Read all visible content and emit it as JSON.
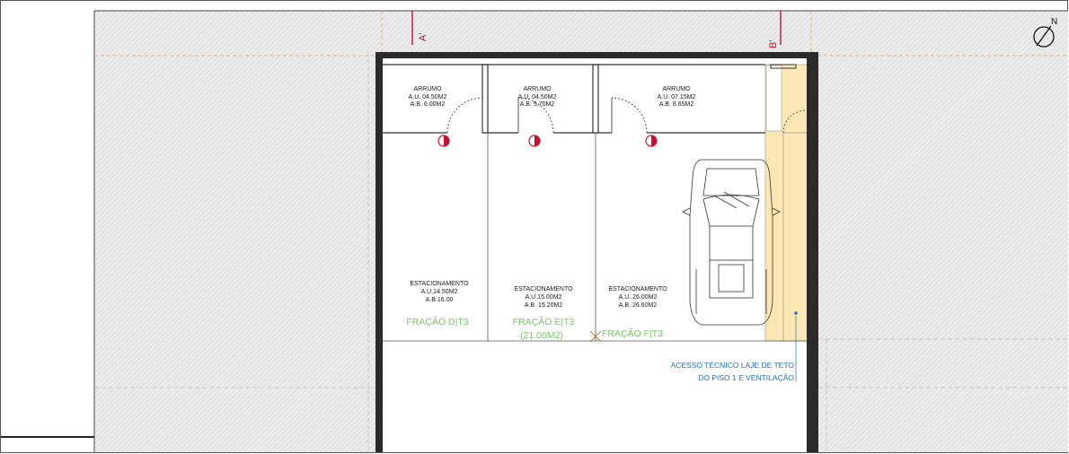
{
  "section_marks": {
    "a": "A'",
    "b": "B'"
  },
  "north_label": "N",
  "storage": [
    {
      "title": "ARRUMO",
      "au": "A.U. 04.50M2",
      "ab": "A.B. 6.00M2"
    },
    {
      "title": "ARRUMO",
      "au": "A.U. 04.50M2",
      "ab": "A.B. 5.70M2"
    },
    {
      "title": "ARRUMO",
      "au": "A.U. 07.15M2",
      "ab": "A.B. 8.65M2"
    }
  ],
  "parking": [
    {
      "title": "ESTACIONAMENTO",
      "au": "A.U.14.50M2",
      "ab": "A.B.16.00",
      "fraction": "FRAÇÃO D|T3",
      "fraction_area": ""
    },
    {
      "title": "ESTACIONAMENTO",
      "au": "A.U.15.00M2",
      "ab": "A.B. 15.20M2",
      "fraction": "FRAÇÃO E|T3",
      "fraction_area": "(21.00M2)"
    },
    {
      "title": "ESTACIONAMENTO",
      "au": "A.U. 26.00M2",
      "ab": "A.B. 26.60M2",
      "fraction": "FRAÇÃO F|T3",
      "fraction_area": ""
    }
  ],
  "technical_access": {
    "line1": "ACESSO TÉCNICO LAJE DE TETO",
    "line2": "DO PISO 1 E VENTILAÇÃO"
  },
  "colors": {
    "wall": "#2b2b2b",
    "wall_accent": "#7a2a1f",
    "hatch_area": "#e6e6e6",
    "technical_shaft": "#fbe6b4",
    "fraction_green": "#7cc46a",
    "annotation_blue": "#2a6fb5",
    "section_red": "#c8102e",
    "axis_orange": "#e0a060"
  }
}
